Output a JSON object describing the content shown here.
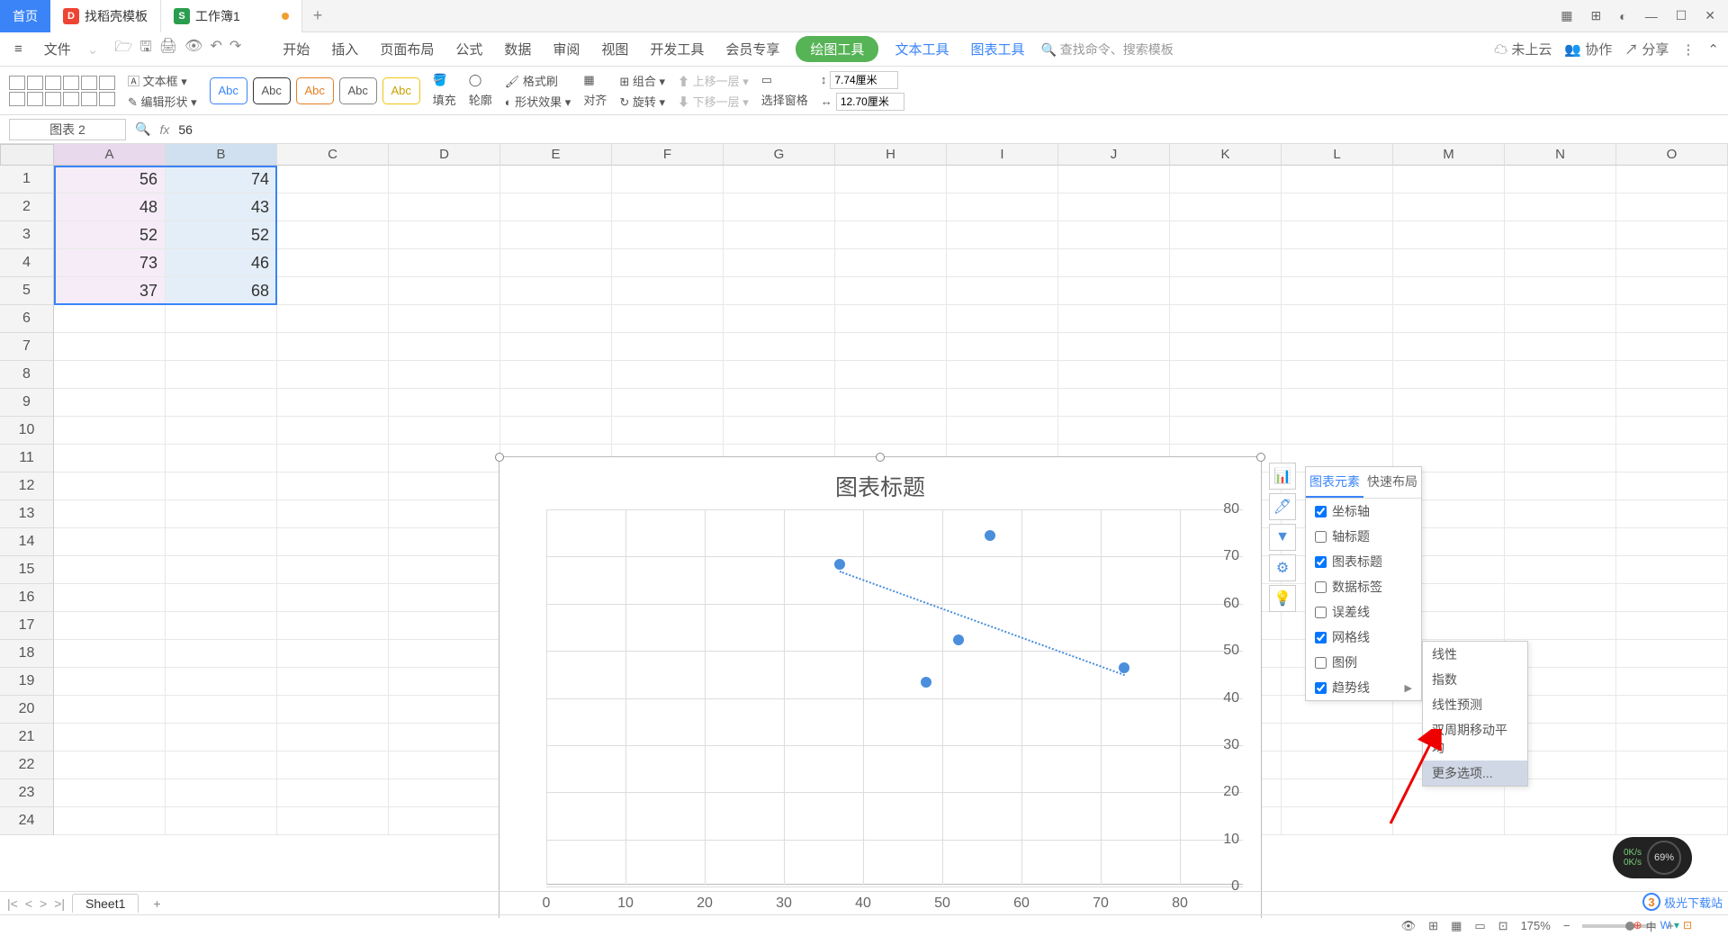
{
  "titlebar": {
    "home": "首页",
    "tpl": "找稻壳模板",
    "doc": "工作簿1",
    "add": "+"
  },
  "winctrl": {
    "grid": "▦",
    "apps": "⊞",
    "user": "◐",
    "min": "—",
    "max": "☐",
    "close": "✕"
  },
  "quickbar": {
    "menu": "≡",
    "file": "文件"
  },
  "menus": [
    "开始",
    "插入",
    "页面布局",
    "公式",
    "数据",
    "审阅",
    "视图",
    "开发工具",
    "会员专享"
  ],
  "menu_draw": "绘图工具",
  "menu_text": "文本工具",
  "menu_chart": "图表工具",
  "search_placeholder": "查找命令、搜索模板",
  "right_menu": {
    "cloud": "未上云",
    "collab": "协作",
    "share": "分享"
  },
  "ribbon": {
    "textbox": "文本框",
    "editshape": "编辑形状",
    "abc": "Abc",
    "fill": "填充",
    "outline": "轮廓",
    "effect": "形状效果",
    "fmtpaint": "格式刷",
    "align": "对齐",
    "group": "组合",
    "rotate": "旋转",
    "forward": "上移一层",
    "backward": "下移一层",
    "selpane": "选择窗格",
    "w": "7.74厘米",
    "h": "12.70厘米"
  },
  "fbar": {
    "name": "图表 2",
    "val": "56"
  },
  "colLetters": [
    "A",
    "B",
    "C",
    "D",
    "E",
    "F",
    "G",
    "H",
    "I",
    "J",
    "K",
    "L",
    "M",
    "N",
    "O"
  ],
  "rows": 24,
  "cells": {
    "A": [
      56,
      48,
      52,
      73,
      37
    ],
    "B": [
      74,
      43,
      52,
      46,
      68
    ]
  },
  "chart_data": {
    "type": "scatter",
    "title": "图表标题",
    "x": [
      56,
      48,
      52,
      73,
      37
    ],
    "y": [
      74,
      43,
      52,
      46,
      68
    ],
    "xlim": [
      0,
      80
    ],
    "ylim": [
      0,
      80
    ],
    "xticks": [
      0,
      10,
      20,
      30,
      40,
      50,
      60,
      70,
      80
    ],
    "yticks": [
      0,
      10,
      20,
      30,
      40,
      50,
      60,
      70,
      80
    ],
    "trendline": {
      "x1": 37,
      "y1": 67,
      "x2": 73,
      "y2": 45
    }
  },
  "elpanel": {
    "tab1": "图表元素",
    "tab2": "快速布局",
    "items": [
      {
        "label": "坐标轴",
        "checked": true
      },
      {
        "label": "轴标题",
        "checked": false
      },
      {
        "label": "图表标题",
        "checked": true
      },
      {
        "label": "数据标签",
        "checked": false
      },
      {
        "label": "误差线",
        "checked": false
      },
      {
        "label": "网格线",
        "checked": true
      },
      {
        "label": "图例",
        "checked": false
      },
      {
        "label": "趋势线",
        "checked": true,
        "chev": true
      }
    ]
  },
  "submenu": [
    "线性",
    "指数",
    "线性预测",
    "双周期移动平均",
    "更多选项..."
  ],
  "sheettab": "Sheet1",
  "status": {
    "zoom": "175%"
  },
  "perf": {
    "up": "0K/s",
    "down": "0K/s",
    "pct": "69%"
  },
  "logo_text": "极光下载站"
}
